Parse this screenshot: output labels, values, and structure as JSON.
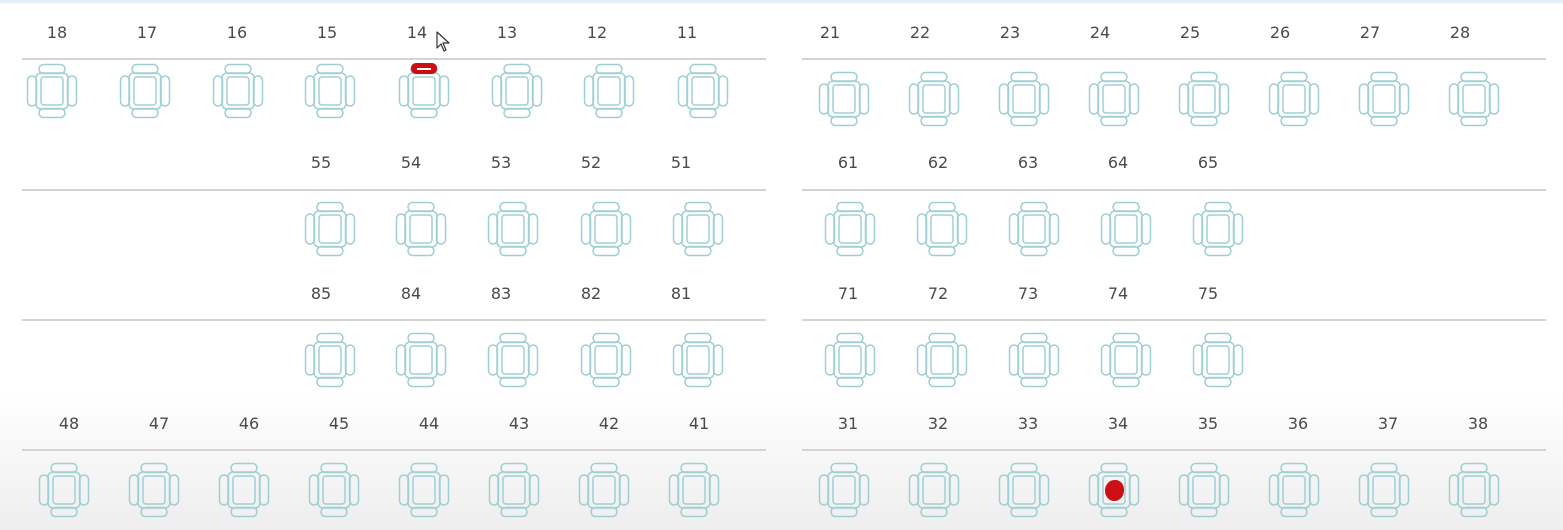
{
  "accent_color": "#9fcfd3",
  "marker_color": "#cc0f14",
  "rows": [
    {
      "name": "upper",
      "left_teeth": [
        "18",
        "17",
        "16",
        "15",
        "14",
        "13",
        "12",
        "11"
      ],
      "right_teeth": [
        "21",
        "22",
        "23",
        "24",
        "25",
        "26",
        "27",
        "28"
      ]
    },
    {
      "name": "upper-deciduous",
      "left_teeth": [
        "55",
        "54",
        "53",
        "52",
        "51"
      ],
      "right_teeth": [
        "61",
        "62",
        "63",
        "64",
        "65"
      ]
    },
    {
      "name": "lower-deciduous",
      "left_teeth": [
        "85",
        "84",
        "83",
        "82",
        "81"
      ],
      "right_teeth": [
        "71",
        "72",
        "73",
        "74",
        "75"
      ]
    },
    {
      "name": "lower",
      "left_teeth": [
        "48",
        "47",
        "46",
        "45",
        "44",
        "43",
        "42",
        "41"
      ],
      "right_teeth": [
        "31",
        "32",
        "33",
        "34",
        "35",
        "36",
        "37",
        "38"
      ]
    }
  ],
  "markers": [
    {
      "tooth": "14",
      "surface": "occlusal-bar",
      "icon": "red-bar-marker"
    },
    {
      "tooth": "34",
      "surface": "center",
      "icon": "red-dot-marker"
    }
  ]
}
